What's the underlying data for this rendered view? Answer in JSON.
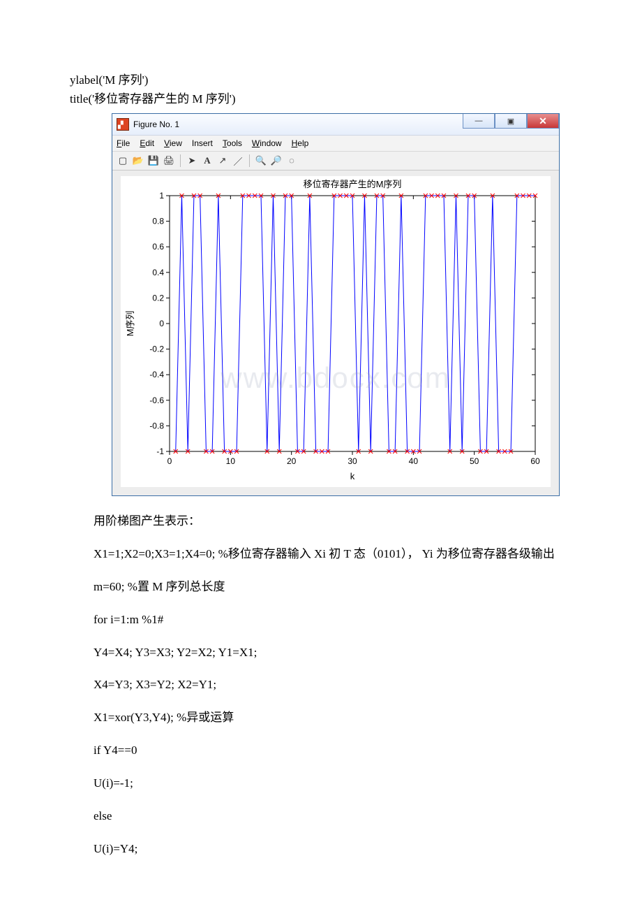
{
  "precode": {
    "line1": "ylabel('M 序列')",
    "line2": "title('移位寄存器产生的 M 序列')"
  },
  "figure_window": {
    "title": "Figure No. 1",
    "menus": {
      "file": "File",
      "edit": "Edit",
      "view": "View",
      "insert": "Insert",
      "tools": "Tools",
      "window": "Window",
      "help": "Help"
    },
    "toolbar_icons": {
      "new": "new-file-icon",
      "open": "open-icon",
      "save": "save-icon",
      "print": "print-icon",
      "pointer": "pointer-icon",
      "text": "text-icon",
      "arrow": "arrow-icon",
      "line": "line-icon",
      "zoomin": "zoom-in-icon",
      "zoomout": "zoom-out-icon",
      "rotate": "rotate-icon"
    },
    "win_buttons": {
      "min": "—",
      "max": "▣",
      "close": "✕"
    }
  },
  "chart_data": {
    "type": "line",
    "title": "移位寄存器产生的M序列",
    "xlabel": "k",
    "ylabel": "M序列",
    "xlim": [
      0,
      60
    ],
    "ylim": [
      -1,
      1
    ],
    "xticks": [
      0,
      10,
      20,
      30,
      40,
      50,
      60
    ],
    "yticks": [
      -1,
      -0.8,
      -0.6,
      -0.4,
      -0.2,
      0,
      0.2,
      0.4,
      0.6,
      0.8,
      1
    ],
    "marker": "x",
    "line_color": "#0000ff",
    "marker_color": "#ff0000",
    "description": "M-sequence generated by a 4-stage shift register with feedback X1=xor(Y3,Y4), initial state X1..X4 = 1,0,1,0, outputs mapped 0→-1, 1→1, period 15, plotted for k=1..60",
    "x": [
      1,
      2,
      3,
      4,
      5,
      6,
      7,
      8,
      9,
      10,
      11,
      12,
      13,
      14,
      15,
      16,
      17,
      18,
      19,
      20,
      21,
      22,
      23,
      24,
      25,
      26,
      27,
      28,
      29,
      30,
      31,
      32,
      33,
      34,
      35,
      36,
      37,
      38,
      39,
      40,
      41,
      42,
      43,
      44,
      45,
      46,
      47,
      48,
      49,
      50,
      51,
      52,
      53,
      54,
      55,
      56,
      57,
      58,
      59,
      60
    ],
    "values": [
      -1,
      1,
      -1,
      1,
      1,
      -1,
      -1,
      1,
      -1,
      -1,
      -1,
      1,
      1,
      1,
      1,
      -1,
      1,
      -1,
      1,
      1,
      -1,
      -1,
      1,
      -1,
      -1,
      -1,
      1,
      1,
      1,
      1,
      -1,
      1,
      -1,
      1,
      1,
      -1,
      -1,
      1,
      -1,
      -1,
      -1,
      1,
      1,
      1,
      1,
      -1,
      1,
      -1,
      1,
      1,
      -1,
      -1,
      1,
      -1,
      -1,
      -1,
      1,
      1,
      1,
      1
    ]
  },
  "bodytext": {
    "p1": "用阶梯图产生表示：",
    "p2_a": "X1=1;X2=0;X3=1;X4=0; %移位寄存器输入 Xi 初 T 态（0101）， Yi 为移位寄存器各级输出",
    "p3": "m=60; %置 M 序列总长度",
    "p4": "for i=1:m %1#",
    "p5": " Y4=X4; Y3=X3; Y2=X2; Y1=X1;",
    "p6": " X4=Y3; X3=Y2; X2=Y1;",
    "p7": " X1=xor(Y3,Y4); %异或运算",
    "p8": " if Y4==0",
    "p9": " U(i)=-1;",
    "p10": " else",
    "p11": " U(i)=Y4;"
  },
  "watermark": "www.bdocx.com"
}
